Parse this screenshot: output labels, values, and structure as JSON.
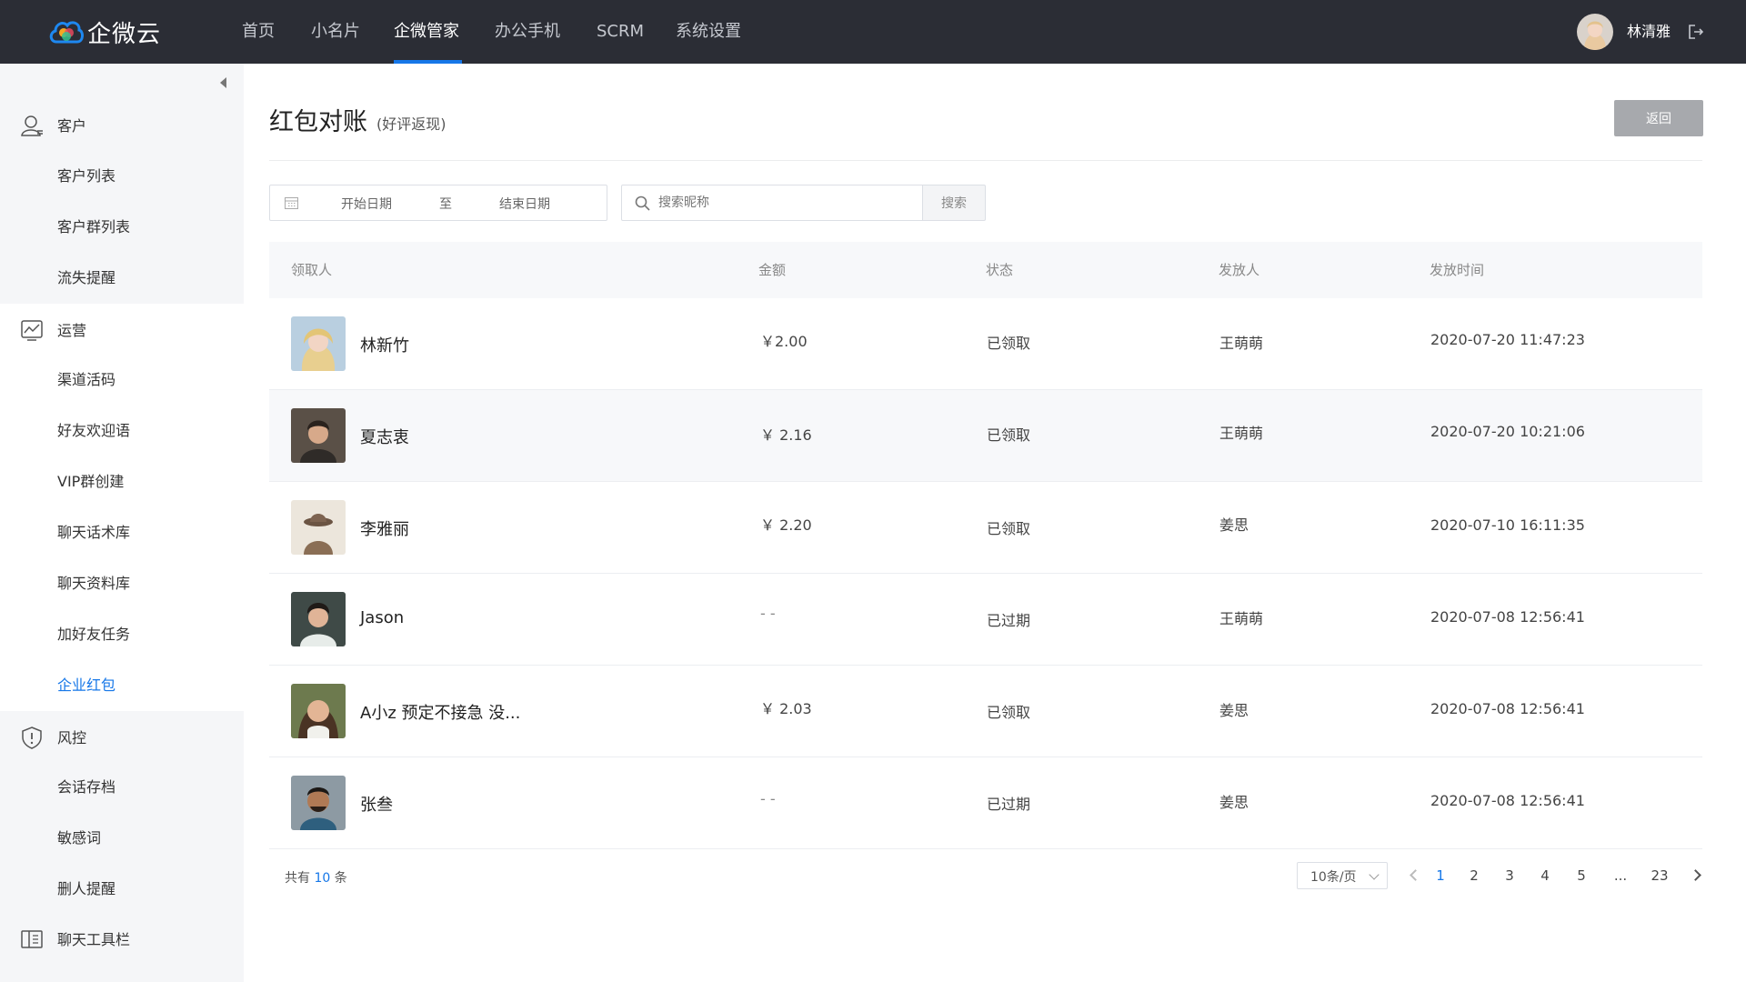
{
  "header": {
    "logo_text": "企微云",
    "nav": [
      {
        "label": "首页"
      },
      {
        "label": "小名片"
      },
      {
        "label": "企微管家"
      },
      {
        "label": "办公手机"
      },
      {
        "label": "SCRM"
      },
      {
        "label": "系统设置"
      }
    ],
    "active_nav_index": 2,
    "user_name": "林清雅"
  },
  "sidebar": {
    "groups": [
      {
        "label": "客户",
        "icon": "user-icon",
        "items": [
          "客户列表",
          "客户群列表",
          "流失提醒"
        ]
      },
      {
        "label": "运营",
        "icon": "chart-icon",
        "items": [
          "渠道活码",
          "好友欢迎语",
          "VIP群创建",
          "聊天话术库",
          "聊天资料库",
          "加好友任务",
          "企业红包"
        ]
      },
      {
        "label": "风控",
        "icon": "shield-icon",
        "items": [
          "会话存档",
          "敏感词",
          "删人提醒"
        ]
      },
      {
        "label": "聊天工具栏",
        "icon": "book-icon",
        "items": []
      }
    ],
    "active_item": "企业红包"
  },
  "main": {
    "title": "红包对账",
    "subtitle": "(好评返现)",
    "back_label": "返回",
    "filter": {
      "start_placeholder": "开始日期",
      "range_sep": "至",
      "end_placeholder": "结束日期",
      "search_placeholder": "搜索昵称",
      "search_label": "搜索"
    },
    "table": {
      "columns": [
        "领取人",
        "金额",
        "状态",
        "发放人",
        "发放时间"
      ],
      "rows": [
        {
          "name": "林新竹",
          "amount": "￥2.00",
          "status": "已领取",
          "issuer": "王萌萌",
          "time": "2020-07-20 11:47:23"
        },
        {
          "name": "夏志衷",
          "amount": "￥ 2.16",
          "status": "已领取",
          "issuer": "王萌萌",
          "time": "2020-07-20 10:21:06"
        },
        {
          "name": "李雅丽",
          "amount": "￥ 2.20",
          "status": "已领取",
          "issuer": "姜思",
          "time": "2020-07-10 16:11:35"
        },
        {
          "name": "Jason",
          "amount": "- -",
          "status": "已过期",
          "issuer": "王萌萌",
          "time": "2020-07-08 12:56:41"
        },
        {
          "name": "A小z 预定不接急 没...",
          "amount": "￥ 2.03",
          "status": "已领取",
          "issuer": "姜思",
          "time": "2020-07-08 12:56:41"
        },
        {
          "name": "张叁",
          "amount": "- -",
          "status": "已过期",
          "issuer": "姜思",
          "time": "2020-07-08 12:56:41"
        }
      ]
    },
    "pagination": {
      "total_prefix": "共有",
      "total": "10",
      "total_suffix": "条",
      "page_size": "10条/页",
      "pages": [
        "1",
        "2",
        "3",
        "4",
        "5",
        "...",
        "23"
      ],
      "current": "1"
    }
  },
  "colors": {
    "topbar": "#2b2d35",
    "accent": "#1677e8",
    "sidebar_bg": "#f5f6f8",
    "back_button": "#a7a9ad"
  }
}
